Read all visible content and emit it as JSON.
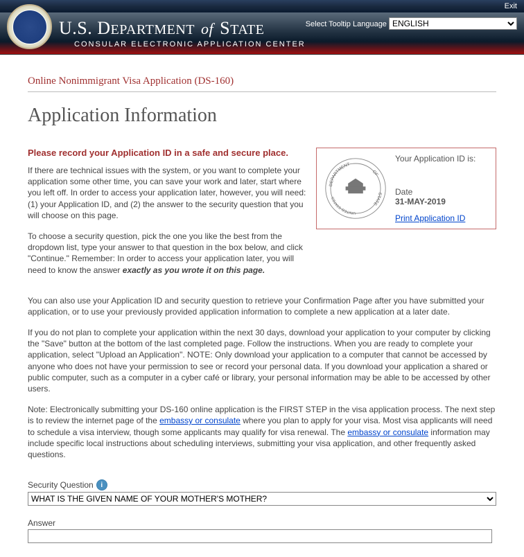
{
  "topbar": {
    "exit": "Exit"
  },
  "header": {
    "dept_line1_prefix": "U.S. D",
    "dept_line1_mid1": "EPARTMENT",
    "dept_line1_of": "of",
    "dept_line1_prefix2": " S",
    "dept_line1_mid2": "TATE",
    "dept_line2": "CONSULAR ELECTRONIC APPLICATION CENTER",
    "lang_label": "Select Tooltip Language",
    "lang_value": "ENGLISH"
  },
  "page": {
    "badge": "Online Nonimmigrant Visa Application (DS-160)",
    "heading": "Application Information",
    "warn": "Please record your Application ID in a safe and secure place.",
    "p1": "If there are technical issues with the system, or you want to complete your application some other time, you can save your work and later, start where you left off. In order to access your application later, however, you will need: (1) your Application ID, and (2) the answer to the security question that you will choose on this page.",
    "p2a": "To choose a security question, pick the one you like the best from the dropdown list, type your answer to that question in the box below, and click \"Continue.\" Remember: In order to access your application later, you will need to know the answer ",
    "p2b": "exactly as you wrote it on this page.",
    "p3": "You can also use your Application ID and security question to retrieve your Confirmation Page after you have submitted your application, or to use your previously provided application information to complete a new application at a later date.",
    "p4": "If you do not plan to complete your application within the next 30 days, download your application to your computer by clicking the \"Save\" button at the bottom of the last completed page. Follow the instructions. When you are ready to complete your application, select \"Upload an Application\". NOTE: Only download your application to a computer that cannot be accessed by anyone who does not have your permission to see or record your personal data. If you download your application a shared or public computer, such as a computer in a cyber café or library, your personal information may be able to be accessed by other users.",
    "p5a": "Note: Electronically submitting your DS-160 online application is the FIRST STEP in the visa application process. The next step is to review the internet page of the ",
    "p5link": "embassy or consulate",
    "p5b": " where you plan to apply for your visa. Most visa applicants will need to schedule a visa interview, though some applicants may qualify for visa renewal. The ",
    "p5c": " information may include specific local instructions about scheduling interviews, submitting your visa application, and other frequently asked questions."
  },
  "idbox": {
    "label": "Your Application ID is:",
    "date_label": "Date",
    "date_value": "31-MAY-2019",
    "print_link": "Print Application ID"
  },
  "secq": {
    "label": "Security Question",
    "selected": "WHAT IS THE GIVEN NAME OF YOUR MOTHER'S MOTHER?",
    "answer_label": "Answer",
    "answer_value": ""
  }
}
